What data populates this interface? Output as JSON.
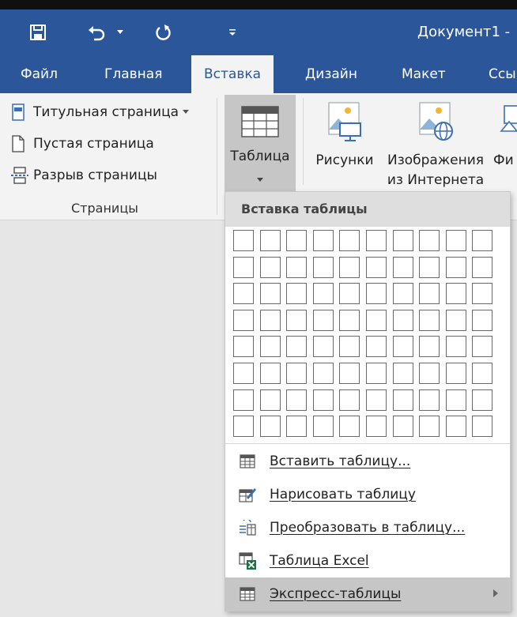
{
  "window": {
    "title": "Документ1 - "
  },
  "quick_access": {
    "save_icon": "save-icon",
    "undo_icon": "undo-icon",
    "redo_icon": "repeat-icon",
    "customize_icon": "customize-icon"
  },
  "tabs": [
    {
      "label": "Файл",
      "active": false
    },
    {
      "label": "Главная",
      "active": false
    },
    {
      "label": "Вставка",
      "active": true
    },
    {
      "label": "Дизайн",
      "active": false
    },
    {
      "label": "Макет",
      "active": false
    },
    {
      "label": "Ссы",
      "active": false
    }
  ],
  "ribbon": {
    "pages": {
      "cover_page": "Титульная страница",
      "blank_page": "Пустая страница",
      "page_break": "Разрыв страницы",
      "group_label": "Страницы"
    },
    "table": {
      "label": "Таблица"
    },
    "pictures": {
      "label": "Рисунки"
    },
    "online_pictures": {
      "label_line1": "Изображения",
      "label_line2": "из Интернета"
    },
    "shapes": {
      "label": "Фи"
    }
  },
  "table_dropdown": {
    "header": "Вставка таблицы",
    "grid": {
      "columns": 10,
      "rows": 8
    },
    "items": [
      {
        "label": "Вставить таблицу...",
        "icon": "insert-table-icon",
        "highlighted": false
      },
      {
        "label": "Нарисовать таблицу",
        "icon": "draw-table-icon",
        "highlighted": false
      },
      {
        "label": "Преобразовать в таблицу...",
        "icon": "convert-to-table-icon",
        "highlighted": false
      },
      {
        "label": "Таблица Excel",
        "icon": "excel-table-icon",
        "highlighted": false
      },
      {
        "label": "Экспресс-таблицы",
        "icon": "quick-tables-icon",
        "highlighted": true,
        "has_submenu": true
      }
    ]
  },
  "colors": {
    "brand": "#2b579a",
    "ribbon_bg": "#f3f3f3",
    "hover": "#c6c6c6",
    "excel_green": "#1e7145"
  }
}
